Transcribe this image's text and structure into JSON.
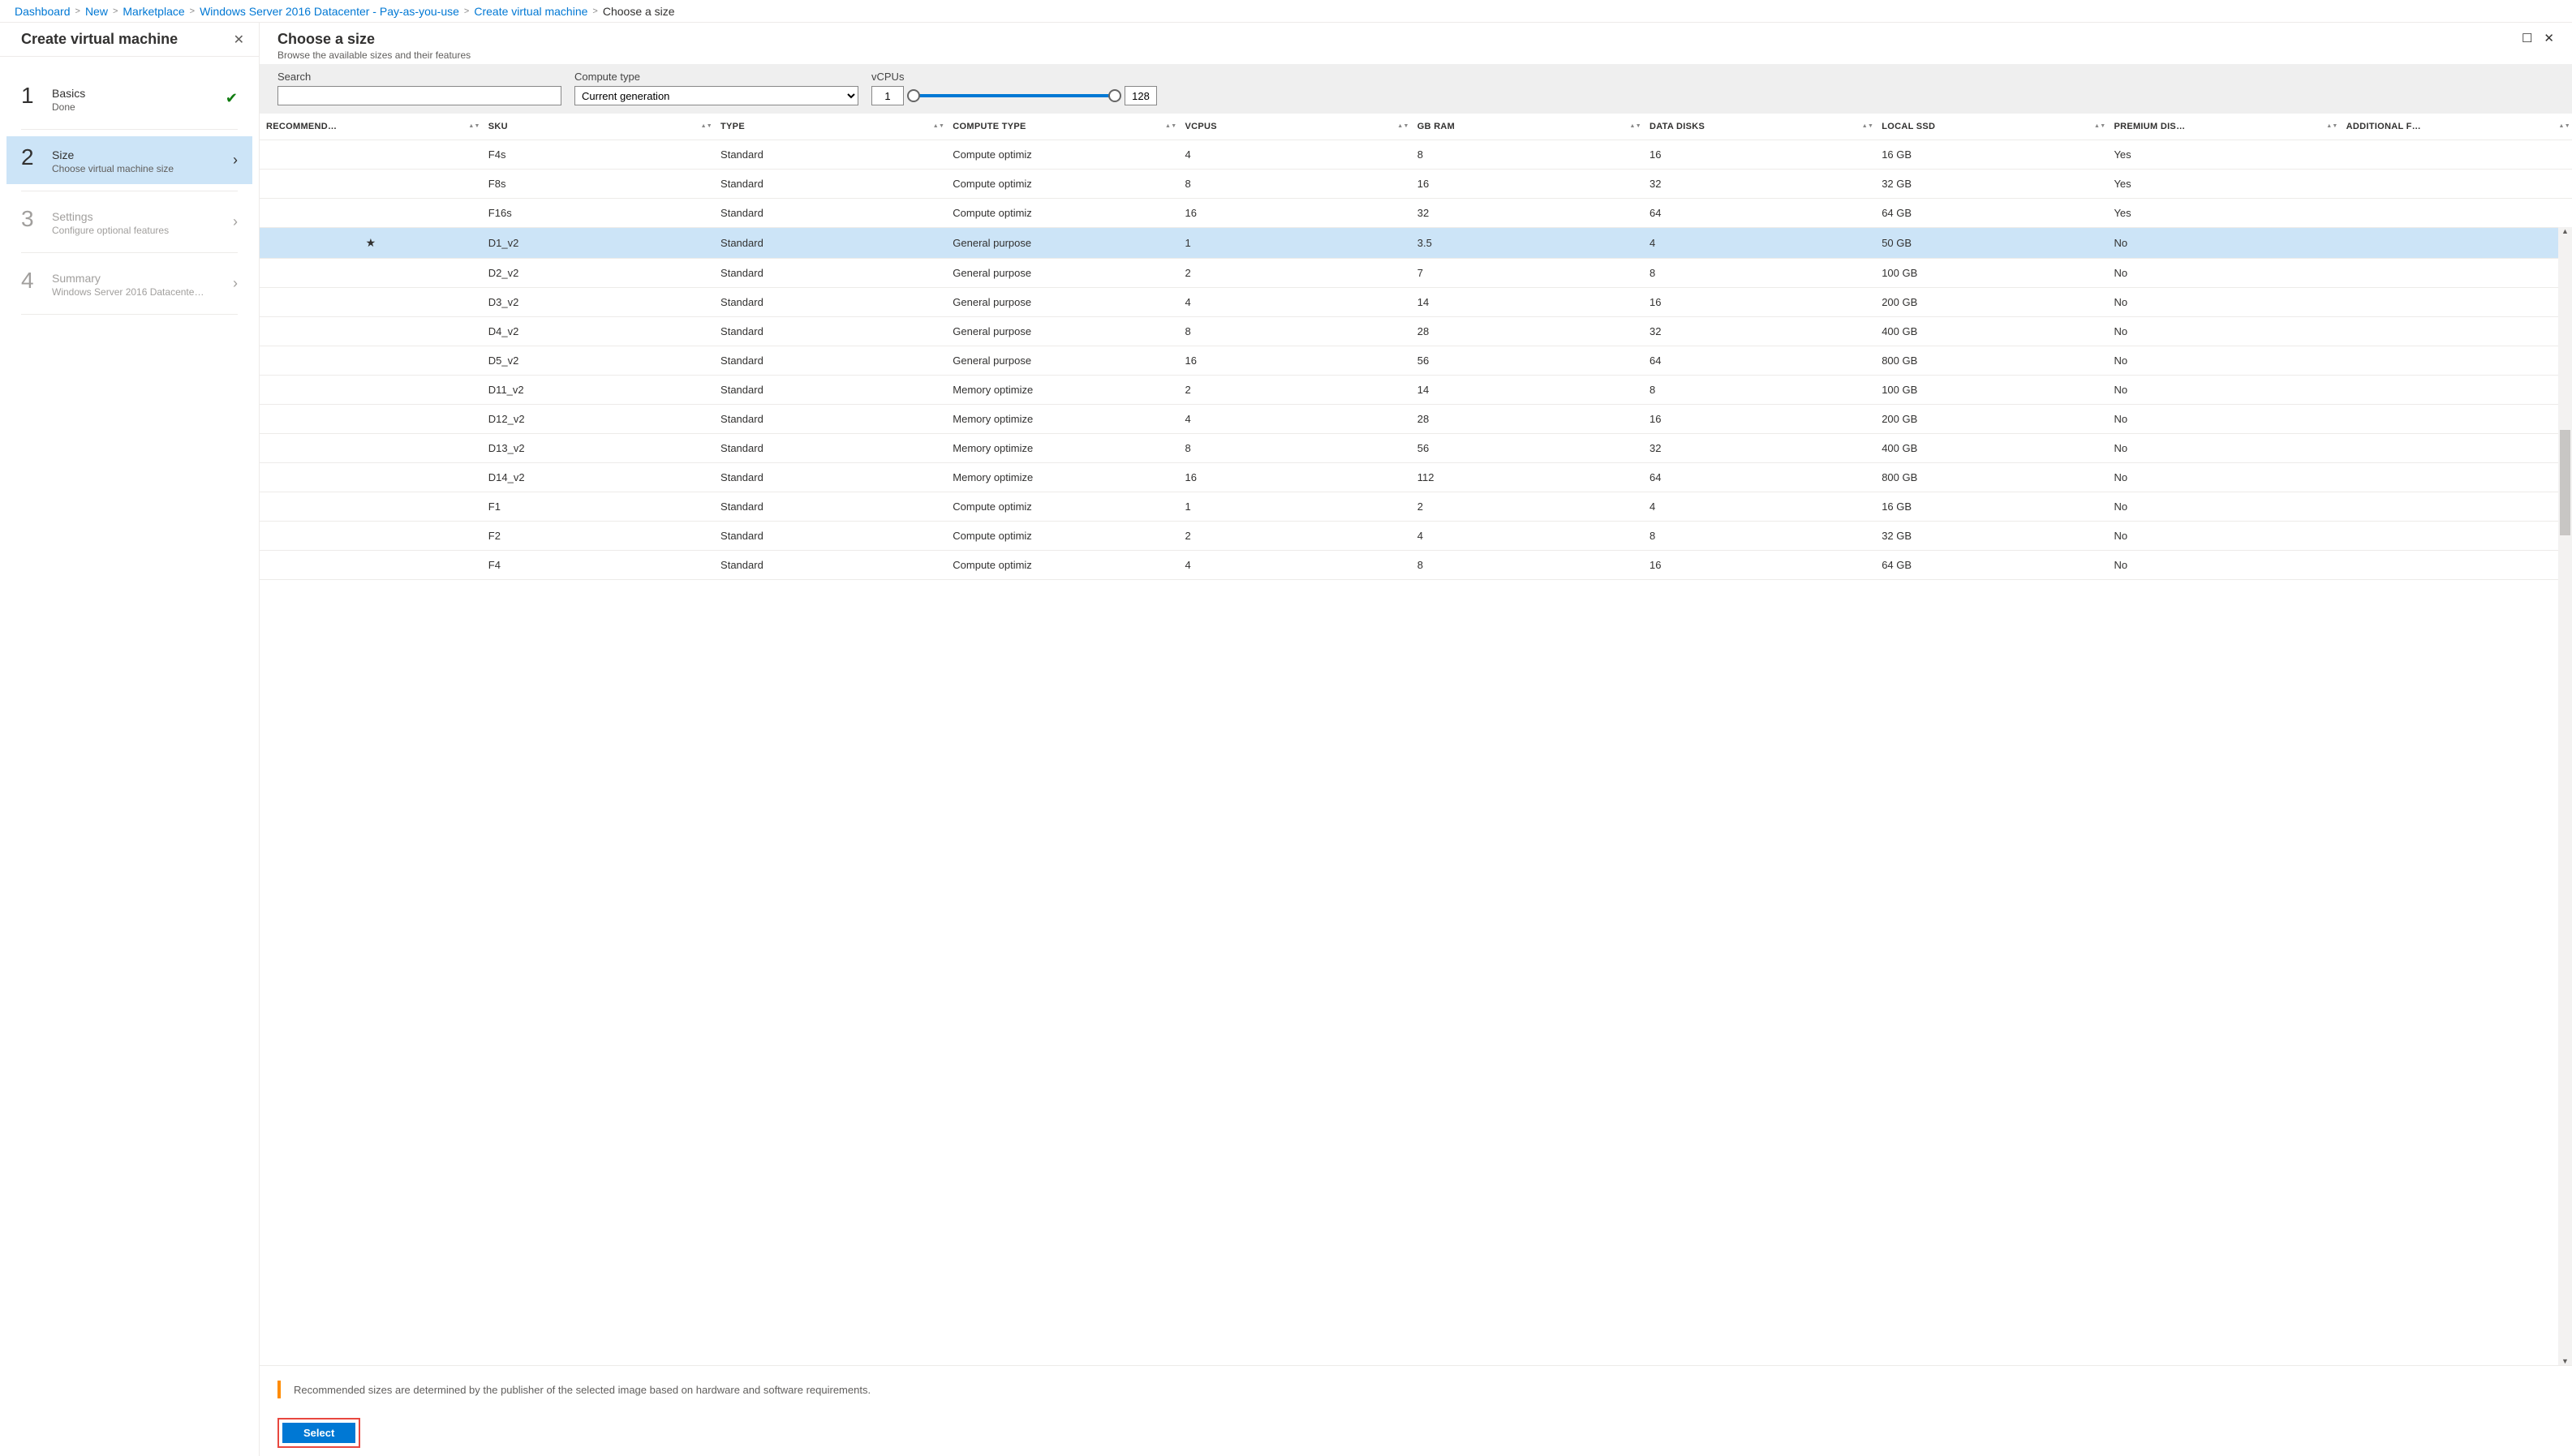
{
  "breadcrumb": {
    "b0": "Dashboard",
    "b1": "New",
    "b2": "Marketplace",
    "b3": "Windows Server 2016 Datacenter - Pay-as-you-use",
    "b4": "Create virtual machine",
    "current": "Choose a size"
  },
  "left": {
    "title": "Create virtual machine",
    "steps": {
      "s1n": "1",
      "s1t": "Basics",
      "s1s": "Done",
      "s2n": "2",
      "s2t": "Size",
      "s2s": "Choose virtual machine size",
      "s3n": "3",
      "s3t": "Settings",
      "s3s": "Configure optional features",
      "s4n": "4",
      "s4t": "Summary",
      "s4s": "Windows Server 2016 Datacenter …"
    }
  },
  "right": {
    "title": "Choose a size",
    "subtitle": "Browse the available sizes and their features",
    "filters": {
      "search_label": "Search",
      "search_value": "",
      "compute_label": "Compute type",
      "compute_value": "Current generation",
      "vcpus_label": "vCPUs",
      "vcpus_min": "1",
      "vcpus_max": "128"
    },
    "columns": {
      "c0": "RECOMMEND…",
      "c1": "SKU",
      "c2": "TYPE",
      "c3": "COMPUTE TYPE",
      "c4": "VCPUS",
      "c5": "GB RAM",
      "c6": "DATA DISKS",
      "c7": "LOCAL SSD",
      "c8": "PREMIUM DIS…",
      "c9": "ADDITIONAL F…"
    },
    "rows": [
      {
        "rec": "",
        "sku": "F4s",
        "type": "Standard",
        "ctype": "Compute optimiz",
        "vcpu": "4",
        "ram": "8",
        "dd": "16",
        "ssd": "16 GB",
        "prem": "Yes",
        "af": ""
      },
      {
        "rec": "",
        "sku": "F8s",
        "type": "Standard",
        "ctype": "Compute optimiz",
        "vcpu": "8",
        "ram": "16",
        "dd": "32",
        "ssd": "32 GB",
        "prem": "Yes",
        "af": ""
      },
      {
        "rec": "",
        "sku": "F16s",
        "type": "Standard",
        "ctype": "Compute optimiz",
        "vcpu": "16",
        "ram": "32",
        "dd": "64",
        "ssd": "64 GB",
        "prem": "Yes",
        "af": ""
      },
      {
        "rec": "★",
        "sku": "D1_v2",
        "type": "Standard",
        "ctype": "General purpose",
        "vcpu": "1",
        "ram": "3.5",
        "dd": "4",
        "ssd": "50 GB",
        "prem": "No",
        "af": "",
        "selected": true
      },
      {
        "rec": "",
        "sku": "D2_v2",
        "type": "Standard",
        "ctype": "General purpose",
        "vcpu": "2",
        "ram": "7",
        "dd": "8",
        "ssd": "100 GB",
        "prem": "No",
        "af": ""
      },
      {
        "rec": "",
        "sku": "D3_v2",
        "type": "Standard",
        "ctype": "General purpose",
        "vcpu": "4",
        "ram": "14",
        "dd": "16",
        "ssd": "200 GB",
        "prem": "No",
        "af": ""
      },
      {
        "rec": "",
        "sku": "D4_v2",
        "type": "Standard",
        "ctype": "General purpose",
        "vcpu": "8",
        "ram": "28",
        "dd": "32",
        "ssd": "400 GB",
        "prem": "No",
        "af": ""
      },
      {
        "rec": "",
        "sku": "D5_v2",
        "type": "Standard",
        "ctype": "General purpose",
        "vcpu": "16",
        "ram": "56",
        "dd": "64",
        "ssd": "800 GB",
        "prem": "No",
        "af": ""
      },
      {
        "rec": "",
        "sku": "D11_v2",
        "type": "Standard",
        "ctype": "Memory optimize",
        "vcpu": "2",
        "ram": "14",
        "dd": "8",
        "ssd": "100 GB",
        "prem": "No",
        "af": ""
      },
      {
        "rec": "",
        "sku": "D12_v2",
        "type": "Standard",
        "ctype": "Memory optimize",
        "vcpu": "4",
        "ram": "28",
        "dd": "16",
        "ssd": "200 GB",
        "prem": "No",
        "af": ""
      },
      {
        "rec": "",
        "sku": "D13_v2",
        "type": "Standard",
        "ctype": "Memory optimize",
        "vcpu": "8",
        "ram": "56",
        "dd": "32",
        "ssd": "400 GB",
        "prem": "No",
        "af": ""
      },
      {
        "rec": "",
        "sku": "D14_v2",
        "type": "Standard",
        "ctype": "Memory optimize",
        "vcpu": "16",
        "ram": "112",
        "dd": "64",
        "ssd": "800 GB",
        "prem": "No",
        "af": ""
      },
      {
        "rec": "",
        "sku": "F1",
        "type": "Standard",
        "ctype": "Compute optimiz",
        "vcpu": "1",
        "ram": "2",
        "dd": "4",
        "ssd": "16 GB",
        "prem": "No",
        "af": ""
      },
      {
        "rec": "",
        "sku": "F2",
        "type": "Standard",
        "ctype": "Compute optimiz",
        "vcpu": "2",
        "ram": "4",
        "dd": "8",
        "ssd": "32 GB",
        "prem": "No",
        "af": ""
      },
      {
        "rec": "",
        "sku": "F4",
        "type": "Standard",
        "ctype": "Compute optimiz",
        "vcpu": "4",
        "ram": "8",
        "dd": "16",
        "ssd": "64 GB",
        "prem": "No",
        "af": ""
      }
    ],
    "hint": "Recommended sizes are determined by the publisher of the selected image based on hardware and software requirements.",
    "select_btn": "Select"
  }
}
